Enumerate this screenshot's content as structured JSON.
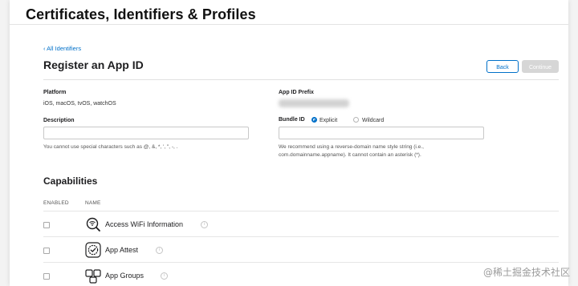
{
  "header": {
    "title": "Certificates, Identifiers & Profiles"
  },
  "nav": {
    "back_link": "‹ All Identifiers"
  },
  "form": {
    "title": "Register an App ID",
    "back_button": "Back",
    "continue_button": "Continue",
    "platform_label": "Platform",
    "platform_value": "iOS, macOS, tvOS, watchOS",
    "app_id_prefix_label": "App ID Prefix",
    "description_label": "Description",
    "description_value": "",
    "description_hint": "You cannot use special characters such as @, &, *, ', \", -, .",
    "bundle_id_label": "Bundle ID",
    "bundle_options": [
      {
        "label": "Explicit",
        "selected": true
      },
      {
        "label": "Wildcard",
        "selected": false
      }
    ],
    "bundle_value": "",
    "bundle_hint_line1": "We recommend using a reverse-domain name style string (i.e.,",
    "bundle_hint_line2": "com.domainname.appname). It cannot contain an asterisk (*)."
  },
  "capabilities": {
    "title": "Capabilities",
    "columns": {
      "enabled": "ENABLED",
      "name": "NAME"
    },
    "rows": [
      {
        "name": "Access WiFi Information",
        "icon": "wifi-search-icon",
        "enabled": false
      },
      {
        "name": "App Attest",
        "icon": "shield-check-icon",
        "enabled": false
      },
      {
        "name": "App Groups",
        "icon": "app-groups-icon",
        "enabled": false
      }
    ]
  },
  "watermark": "@稀土掘金技术社区",
  "colors": {
    "link": "#0070c9",
    "disabled_button": "#d6d6d6"
  }
}
